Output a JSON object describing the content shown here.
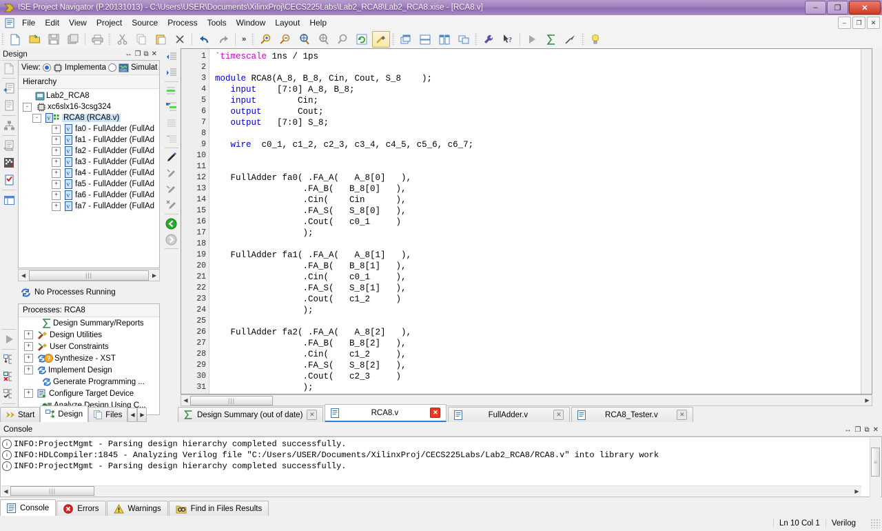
{
  "window": {
    "title": "ISE Project Navigator (P.20131013) - C:\\Users\\USER\\Documents\\XilinxProj\\CECS225Labs\\Lab2_RCA8\\Lab2_RCA8.xise - [RCA8.v]",
    "minimize": "–",
    "restore": "❐",
    "close": "✕",
    "inner_minimize": "–",
    "inner_restore": "❐",
    "inner_close": "✕"
  },
  "menubar": {
    "items": [
      {
        "label": "File"
      },
      {
        "label": "Edit"
      },
      {
        "label": "View"
      },
      {
        "label": "Project"
      },
      {
        "label": "Source"
      },
      {
        "label": "Process"
      },
      {
        "label": "Tools"
      },
      {
        "label": "Window"
      },
      {
        "label": "Layout"
      },
      {
        "label": "Help"
      }
    ]
  },
  "toolbar": {
    "overflow_label": "»",
    "buttons": [
      "new-file-icon",
      "open-project-icon",
      "save-icon",
      "save-all-icon",
      "print-icon",
      "cut-icon",
      "copy-icon",
      "paste-icon",
      "delete-icon",
      "undo-icon",
      "redo-icon",
      "zoom-in-icon",
      "zoom-out-icon",
      "zoom-fit-icon",
      "zoom-select-icon",
      "refresh-icon",
      "build-icon",
      "cascade-icon",
      "tile-horizontal-icon",
      "tile-vertical-icon",
      "float-icon",
      "options-icon",
      "context-help-icon",
      "run-icon",
      "sum-icon",
      "pin-icon",
      "tip-icon"
    ]
  },
  "design_panel": {
    "title": "Design",
    "header_buttons": [
      "resize-icon",
      "maximize-icon",
      "float-icon",
      "close-icon"
    ],
    "view": {
      "label": "View:",
      "options": [
        {
          "label": "Implementa",
          "selected": true
        },
        {
          "label": "Simulat",
          "selected": false
        }
      ]
    },
    "hierarchy": {
      "title": "Hierarchy",
      "nodes": [
        {
          "label": "Lab2_RCA8",
          "depth": 0,
          "expander": "",
          "icon": "project-icon"
        },
        {
          "label": "xc6slx16-3csg324",
          "depth": 0,
          "expander": "-",
          "icon": "chip-icon"
        },
        {
          "label": "RCA8 (RCA8.v)",
          "depth": 1,
          "expander": "-",
          "icon": "verilog-module-icon",
          "selected": true
        },
        {
          "label": "fa0 - FullAdder (FullAd",
          "depth": 2,
          "expander": "+",
          "icon": "verilog-file-icon"
        },
        {
          "label": "fa1 - FullAdder (FullAd",
          "depth": 2,
          "expander": "+",
          "icon": "verilog-file-icon"
        },
        {
          "label": "fa2 - FullAdder (FullAd",
          "depth": 2,
          "expander": "+",
          "icon": "verilog-file-icon"
        },
        {
          "label": "fa3 - FullAdder (FullAd",
          "depth": 2,
          "expander": "+",
          "icon": "verilog-file-icon"
        },
        {
          "label": "fa4 - FullAdder (FullAd",
          "depth": 2,
          "expander": "+",
          "icon": "verilog-file-icon"
        },
        {
          "label": "fa5 - FullAdder (FullAd",
          "depth": 2,
          "expander": "+",
          "icon": "verilog-file-icon"
        },
        {
          "label": "fa6 - FullAdder (FullAd",
          "depth": 2,
          "expander": "+",
          "icon": "verilog-file-icon"
        },
        {
          "label": "fa7 - FullAdder (FullAd",
          "depth": 2,
          "expander": "+",
          "icon": "verilog-file-icon"
        }
      ]
    },
    "process_status": "No Processes Running",
    "processes": {
      "title": "Processes: RCA8",
      "items": [
        {
          "label": "Design Summary/Reports",
          "expander": "",
          "icon": "sigma-icon",
          "warn": false
        },
        {
          "label": "Design Utilities",
          "expander": "+",
          "icon": "utilities-icon",
          "warn": false
        },
        {
          "label": "User Constraints",
          "expander": "+",
          "icon": "constraints-icon",
          "warn": false
        },
        {
          "label": "Synthesize - XST",
          "expander": "+",
          "icon": "process-icon",
          "warn": true
        },
        {
          "label": "Implement Design",
          "expander": "+",
          "icon": "process-icon",
          "warn": false
        },
        {
          "label": "Generate Programming ...",
          "expander": "",
          "icon": "process-icon",
          "warn": false
        },
        {
          "label": "Configure Target Device",
          "expander": "+",
          "icon": "configure-icon",
          "warn": false
        },
        {
          "label": "Analyze Design Using C...",
          "expander": "",
          "icon": "analyze-icon",
          "warn": false
        }
      ]
    },
    "tabs": [
      {
        "label": "Start",
        "icon": "start-icon",
        "active": false
      },
      {
        "label": "Design",
        "icon": "design-icon",
        "active": true
      },
      {
        "label": "Files",
        "icon": "files-icon",
        "active": false
      }
    ],
    "tab_nav": [
      "◀",
      "▶"
    ]
  },
  "editor": {
    "language": "Verilog",
    "lines": [
      {
        "n": 1,
        "tokens": [
          {
            "t": "`timescale",
            "c": "dir"
          },
          {
            "t": " 1ns / 1ps",
            "c": ""
          }
        ]
      },
      {
        "n": 2,
        "tokens": [
          {
            "t": "",
            "c": ""
          }
        ]
      },
      {
        "n": 3,
        "tokens": [
          {
            "t": "module",
            "c": "kw"
          },
          {
            "t": " RCA8(A_8, B_8, Cin, Cout, S_8    );",
            "c": ""
          }
        ]
      },
      {
        "n": 4,
        "tokens": [
          {
            "t": "   ",
            "c": ""
          },
          {
            "t": "input",
            "c": "kw"
          },
          {
            "t": "    [7:0] A_8, B_8;",
            "c": ""
          }
        ]
      },
      {
        "n": 5,
        "tokens": [
          {
            "t": "   ",
            "c": ""
          },
          {
            "t": "input",
            "c": "kw"
          },
          {
            "t": "        Cin;",
            "c": ""
          }
        ]
      },
      {
        "n": 6,
        "tokens": [
          {
            "t": "   ",
            "c": ""
          },
          {
            "t": "output",
            "c": "kw"
          },
          {
            "t": "       Cout;",
            "c": ""
          }
        ]
      },
      {
        "n": 7,
        "tokens": [
          {
            "t": "   ",
            "c": ""
          },
          {
            "t": "output",
            "c": "kw"
          },
          {
            "t": "   [7:0] S_8;",
            "c": ""
          }
        ]
      },
      {
        "n": 8,
        "tokens": [
          {
            "t": "",
            "c": ""
          }
        ]
      },
      {
        "n": 9,
        "tokens": [
          {
            "t": "   ",
            "c": ""
          },
          {
            "t": "wire",
            "c": "kw"
          },
          {
            "t": "  c0_1, c1_2, c2_3, c3_4, c4_5, c5_6, c6_7;",
            "c": ""
          }
        ]
      },
      {
        "n": 10,
        "tokens": [
          {
            "t": "",
            "c": ""
          }
        ]
      },
      {
        "n": 11,
        "tokens": [
          {
            "t": "",
            "c": ""
          }
        ]
      },
      {
        "n": 12,
        "tokens": [
          {
            "t": "   FullAdder fa0( .FA_A(   A_8[0]   ),",
            "c": ""
          }
        ]
      },
      {
        "n": 13,
        "tokens": [
          {
            "t": "                 .FA_B(   B_8[0]   ),",
            "c": ""
          }
        ]
      },
      {
        "n": 14,
        "tokens": [
          {
            "t": "                 .Cin(    Cin      ),",
            "c": ""
          }
        ]
      },
      {
        "n": 15,
        "tokens": [
          {
            "t": "                 .FA_S(   S_8[0]   ),",
            "c": ""
          }
        ]
      },
      {
        "n": 16,
        "tokens": [
          {
            "t": "                 .Cout(   c0_1     )",
            "c": ""
          }
        ]
      },
      {
        "n": 17,
        "tokens": [
          {
            "t": "                 );",
            "c": ""
          }
        ]
      },
      {
        "n": 18,
        "tokens": [
          {
            "t": "",
            "c": ""
          }
        ]
      },
      {
        "n": 19,
        "tokens": [
          {
            "t": "   FullAdder fa1( .FA_A(   A_8[1]   ),",
            "c": ""
          }
        ]
      },
      {
        "n": 20,
        "tokens": [
          {
            "t": "                 .FA_B(   B_8[1]   ),",
            "c": ""
          }
        ]
      },
      {
        "n": 21,
        "tokens": [
          {
            "t": "                 .Cin(    c0_1     ),",
            "c": ""
          }
        ]
      },
      {
        "n": 22,
        "tokens": [
          {
            "t": "                 .FA_S(   S_8[1]   ),",
            "c": ""
          }
        ]
      },
      {
        "n": 23,
        "tokens": [
          {
            "t": "                 .Cout(   c1_2     )",
            "c": ""
          }
        ]
      },
      {
        "n": 24,
        "tokens": [
          {
            "t": "                 );",
            "c": ""
          }
        ]
      },
      {
        "n": 25,
        "tokens": [
          {
            "t": "",
            "c": ""
          }
        ]
      },
      {
        "n": 26,
        "tokens": [
          {
            "t": "   FullAdder fa2( .FA_A(   A_8[2]   ),",
            "c": ""
          }
        ]
      },
      {
        "n": 27,
        "tokens": [
          {
            "t": "                 .FA_B(   B_8[2]   ),",
            "c": ""
          }
        ]
      },
      {
        "n": 28,
        "tokens": [
          {
            "t": "                 .Cin(    c1_2     ),",
            "c": ""
          }
        ]
      },
      {
        "n": 29,
        "tokens": [
          {
            "t": "                 .FA_S(   S_8[2]   ),",
            "c": ""
          }
        ]
      },
      {
        "n": 30,
        "tokens": [
          {
            "t": "                 .Cout(   c2_3     )",
            "c": ""
          }
        ]
      },
      {
        "n": 31,
        "tokens": [
          {
            "t": "                 );",
            "c": ""
          }
        ]
      }
    ]
  },
  "doc_tabs": [
    {
      "label": "Design Summary (out of date)",
      "icon": "summary-icon",
      "active": false,
      "close_red": false
    },
    {
      "label": "RCA8.v",
      "icon": "verilog-doc-icon",
      "active": true,
      "close_red": true
    },
    {
      "label": "FullAdder.v",
      "icon": "verilog-doc-icon",
      "active": false,
      "close_red": false
    },
    {
      "label": "RCA8_Tester.v",
      "icon": "verilog-doc-icon",
      "active": false,
      "close_red": false
    }
  ],
  "console": {
    "title": "Console",
    "header_buttons": [
      "resize-icon",
      "maximize-icon",
      "float-icon",
      "close-icon"
    ],
    "messages": [
      "INFO:ProjectMgmt - Parsing design hierarchy completed successfully.",
      "INFO:HDLCompiler:1845 - Analyzing Verilog file \"C:/Users/USER/Documents/XilinxProj/CECS225Labs/Lab2_RCA8/RCA8.v\" into library work",
      "INFO:ProjectMgmt - Parsing design hierarchy completed successfully."
    ],
    "tabs": [
      {
        "label": "Console",
        "icon": "console-icon",
        "active": true
      },
      {
        "label": "Errors",
        "icon": "error-icon",
        "active": false
      },
      {
        "label": "Warnings",
        "icon": "warning-icon",
        "active": false
      },
      {
        "label": "Find in Files Results",
        "icon": "find-icon",
        "active": false
      }
    ]
  },
  "statusbar": {
    "position": "Ln 10 Col 1",
    "language": "Verilog"
  },
  "colors": {
    "title_bar": "#9f7fbe",
    "keyword": "#0000c8",
    "directive": "#cc00cc",
    "selection": "#cfe3f7",
    "accent": "#2a7fd4",
    "error": "#e23c23"
  }
}
